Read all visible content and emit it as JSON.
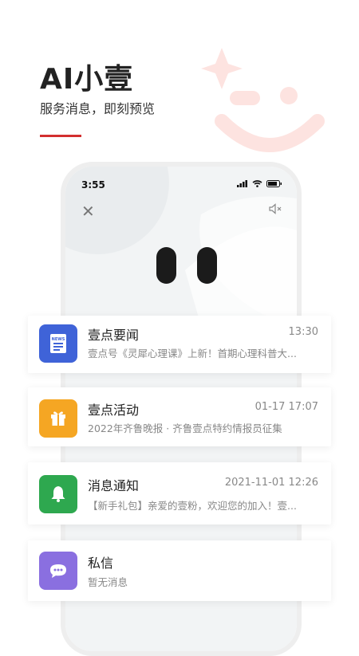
{
  "hero": {
    "title": "AI小壹",
    "subtitle": "服务消息，即刻预览"
  },
  "phone": {
    "status_time": "3:55",
    "close_icon": "close-icon",
    "mute_icon": "volume-mute-icon"
  },
  "messages": [
    {
      "title": "壹点要闻",
      "time": "13:30",
      "preview": "壹点号《灵犀心理课》上新！首期心理科普大...",
      "icon": "news-icon",
      "color": "#3f63d8"
    },
    {
      "title": "壹点活动",
      "time": "01-17 17:07",
      "preview": "2022年齐鲁晚报 · 齐鲁壹点特约情报员征集",
      "icon": "gift-icon",
      "color": "#f5a623"
    },
    {
      "title": "消息通知",
      "time": "2021-11-01 12:26",
      "preview": "【新手礼包】亲爱的壹粉，欢迎您的加入！壹...",
      "icon": "bell-icon",
      "color": "#2ea84f"
    },
    {
      "title": "私信",
      "time": "",
      "preview": "暂无消息",
      "icon": "chat-icon",
      "color": "#8a6fe0"
    }
  ],
  "colors": {
    "accent": "#d32f2f",
    "deco": "#fde8e6"
  }
}
